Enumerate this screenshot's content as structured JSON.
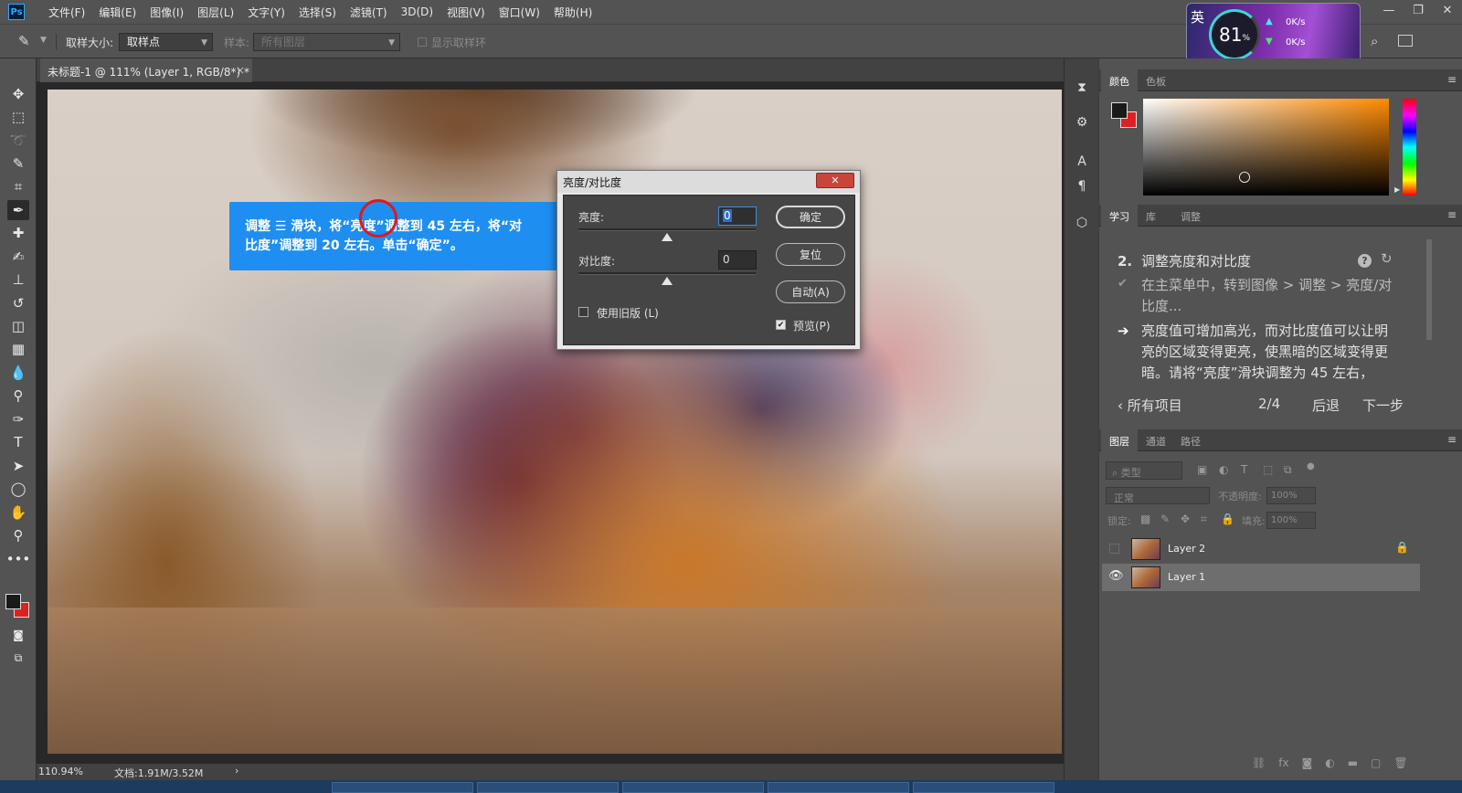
{
  "menubar": {
    "logo": "Ps",
    "items": [
      "文件(F)",
      "编辑(E)",
      "图像(I)",
      "图层(L)",
      "文字(Y)",
      "选择(S)",
      "滤镜(T)",
      "3D(D)",
      "视图(V)",
      "窗口(W)",
      "帮助(H)"
    ],
    "window_controls": [
      "—",
      "❐",
      "✕"
    ]
  },
  "options": {
    "sample_size_label": "取样大小:",
    "sample_size_value": "取样点",
    "sample_label": "样本:",
    "sample_value": "所有图层",
    "show_ring_label": "显示取样环"
  },
  "perf_widget": {
    "percent": "81",
    "unit": "%",
    "up": "0K/s",
    "down": "0K/s",
    "badge": "英"
  },
  "document": {
    "tab_title": "未标题-1 @ 111% (Layer 1, RGB/8*) *",
    "close": "×"
  },
  "callout": {
    "text_line1": "调整 ☰ 滑块，将“亮度”调整到 45 左右，将“对",
    "text_line2": "比度”调整到 20 左右。单击“确定”。"
  },
  "dialog": {
    "title": "亮度/对比度",
    "close": "✕",
    "brightness_label": "亮度:",
    "brightness_value": "0",
    "contrast_label": "对比度:",
    "contrast_value": "0",
    "legacy_label": "使用旧版 (L)",
    "preview_label": "预览(P)",
    "ok_button": "确定",
    "reset_button": "复位",
    "auto_button": "自动(A)",
    "brightness_slider_level": 0.5,
    "contrast_slider_level": 0.5,
    "legacy_checked": false,
    "preview_checked": true
  },
  "status": {
    "zoom": "110.94%",
    "doc": "文档:1.91M/3.52M",
    "arrow": "›"
  },
  "color_panel": {
    "tabs": [
      "颜色",
      "色板"
    ],
    "fg": "#1a1a1a",
    "bg": "#e02020",
    "hue": "#ff8a00"
  },
  "learn_panel": {
    "tabs": [
      "学习",
      "库",
      "调整"
    ],
    "step_number": "2.",
    "step_title": "调整亮度和对比度",
    "done_line1": "在主菜单中，转到图像 > 调整 > 亮度/对",
    "done_line2": "比度...",
    "current_line1": "亮度值可增加高光，而对比度值可以让明",
    "current_line2": "亮的区域变得更亮，使黑暗的区域变得更",
    "current_line3": "暗。请将“亮度”滑块调整为 45 左右，",
    "all_items": "所有项目",
    "progress": "2/4",
    "back": "后退",
    "next": "下一步"
  },
  "layers_panel": {
    "tabs": [
      "图层",
      "通道",
      "路径"
    ],
    "filter_placeholder": "类型",
    "blend_mode": "正常",
    "opacity_label": "不透明度:",
    "opacity_value": "100%",
    "lock_label": "锁定:",
    "fill_label": "填充:",
    "fill_value": "100%",
    "layers": [
      {
        "name": "Layer 2",
        "visible": false,
        "locked": true,
        "selected": false
      },
      {
        "name": "Layer 1",
        "visible": true,
        "locked": false,
        "selected": true
      }
    ]
  }
}
